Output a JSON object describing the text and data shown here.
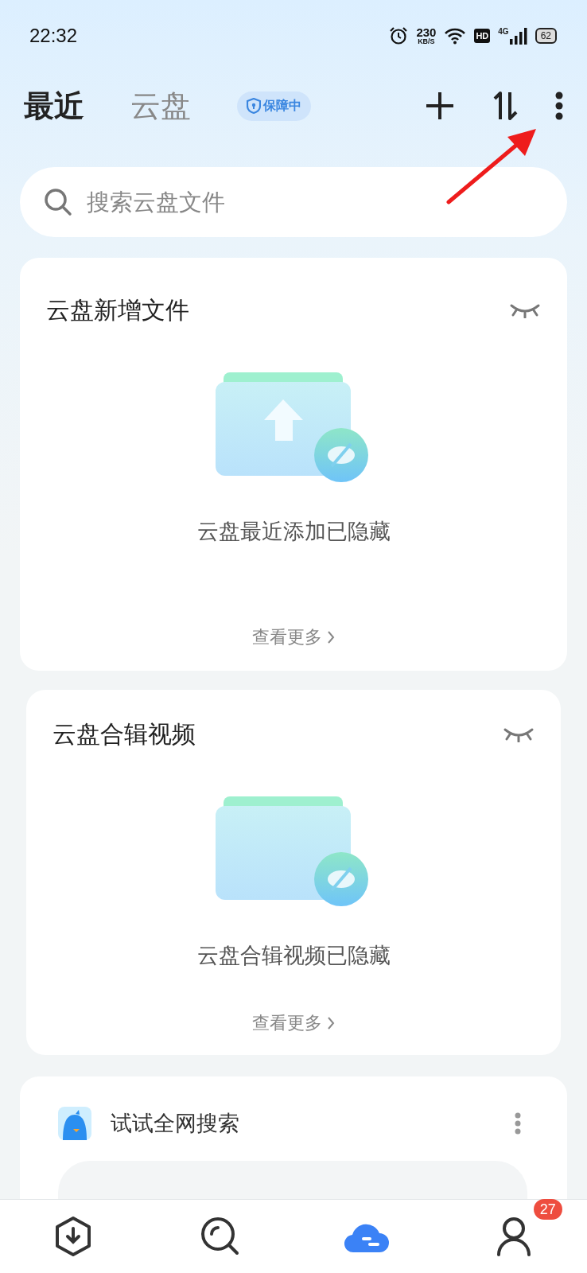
{
  "status_bar": {
    "time": "22:32",
    "speed_value": "230",
    "speed_unit": "KB/S",
    "hd": "HD",
    "network": "4G",
    "battery": "62"
  },
  "header": {
    "tabs": [
      {
        "label": "最近",
        "selected": true
      },
      {
        "label": "云盘",
        "selected": false
      }
    ],
    "badge": "保障中"
  },
  "search": {
    "placeholder": "搜索云盘文件"
  },
  "cards": [
    {
      "kind": "upload",
      "title": "云盘新增文件",
      "caption": "云盘最近添加已隐藏",
      "more": "查看更多"
    },
    {
      "kind": "collection",
      "title": "云盘合辑视频",
      "caption": "云盘合辑视频已隐藏",
      "more": "查看更多"
    }
  ],
  "web_search": {
    "title": "试试全网搜索"
  },
  "bottom_nav": [
    {
      "kind": "download",
      "selected": false
    },
    {
      "kind": "search",
      "selected": false
    },
    {
      "kind": "cloud",
      "selected": true
    },
    {
      "kind": "profile",
      "selected": false,
      "badge": "27"
    }
  ]
}
